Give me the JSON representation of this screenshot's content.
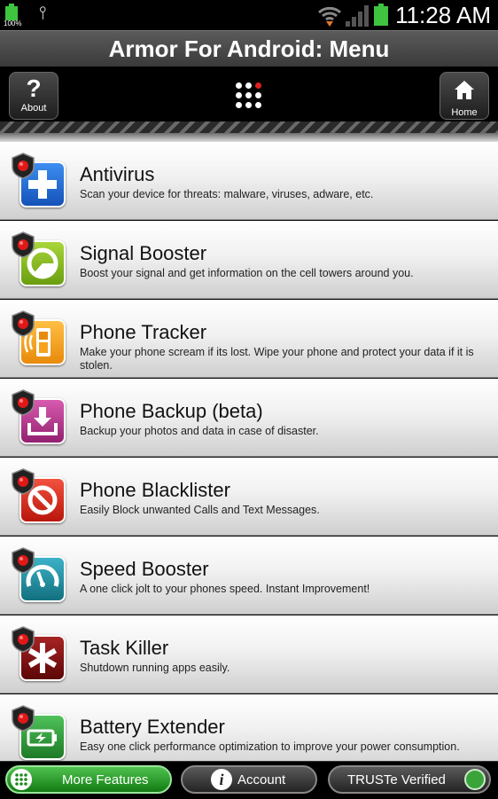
{
  "status_bar": {
    "battery_percent": "100%",
    "time": "11:28 AM"
  },
  "title": "Armor For Android: Menu",
  "toolbar": {
    "about_label": "About",
    "about_glyph": "?",
    "home_label": "Home"
  },
  "menu": {
    "items": [
      {
        "title": "Antivirus",
        "description": "Scan your device for threats: malware, viruses, adware, etc.",
        "icon": "plus-icon",
        "color": "#1f6fd6"
      },
      {
        "title": "Signal Booster",
        "description": "Boost your signal and get information on the cell towers around you.",
        "icon": "signal-circle-icon",
        "color": "#8dc21f"
      },
      {
        "title": "Phone Tracker",
        "description": "Make your phone scream if its lost. Wipe your phone and protect your data if it is stolen.",
        "icon": "phone-icon",
        "color": "#f5a21e"
      },
      {
        "title": "Phone Backup (beta)",
        "description": "Backup your photos and data in case of disaster.",
        "icon": "download-tray-icon",
        "color": "#b8338c"
      },
      {
        "title": "Phone Blacklister",
        "description": "Easily Block unwanted Calls and Text Messages.",
        "icon": "block-icon",
        "color": "#d92a1c"
      },
      {
        "title": "Speed Booster",
        "description": "A one click jolt to your phones speed. Instant Improvement!",
        "icon": "gauge-icon",
        "color": "#1e8fa6"
      },
      {
        "title": "Task Killer",
        "description": "Shutdown running apps easily.",
        "icon": "asterisk-icon",
        "color": "#8a1212"
      },
      {
        "title": "Battery Extender",
        "description": "Easy one click performance optimization to improve your power consumption.",
        "icon": "battery-icon",
        "color": "#2f9e3a"
      }
    ]
  },
  "bottom_bar": {
    "more_features": "More Features",
    "account": "Account",
    "account_glyph": "i",
    "truste": "TRUSTe Verified"
  }
}
